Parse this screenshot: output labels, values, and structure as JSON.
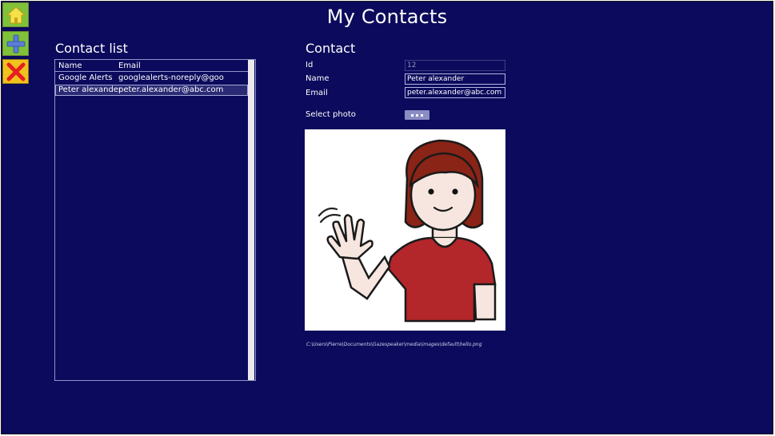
{
  "app": {
    "title": "My Contacts"
  },
  "sidebar": {
    "buttons": [
      {
        "icon": "home-icon",
        "color": "#7fc23a"
      },
      {
        "icon": "plus-icon",
        "color": "#7fc23a"
      },
      {
        "icon": "close-icon",
        "color": "#f0c21e"
      }
    ]
  },
  "contact_list": {
    "title": "Contact list",
    "columns": [
      "Name",
      "Email"
    ],
    "rows": [
      {
        "name": "Google Alerts",
        "email": "googlealerts-noreply@goo"
      },
      {
        "name": "Peter alexander",
        "email": "peter.alexander@abc.com"
      }
    ],
    "selected_index": 1
  },
  "contact": {
    "title": "Contact",
    "id_label": "Id",
    "id_value": "12",
    "name_label": "Name",
    "name_value": "Peter alexander",
    "email_label": "Email",
    "email_value": "peter.alexander@abc.com",
    "photo_label": "Select photo",
    "photo_path": "C:\\Users\\Pierre\\Documents\\Gazespeaker\\media\\images\\default\\hello.png"
  },
  "colors": {
    "background": "#0b0a5c",
    "text": "#ffffff",
    "accent_green": "#7fc23a",
    "accent_yellow": "#f0c21e",
    "delete_red": "#e62020"
  }
}
